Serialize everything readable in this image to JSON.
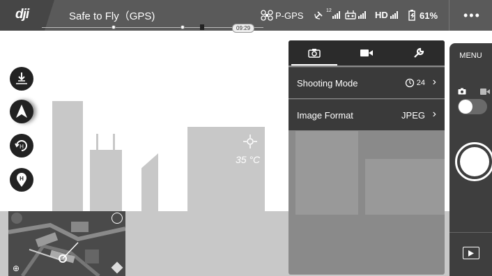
{
  "app": {
    "logo": "dji",
    "flight_status": "Safe to Fly（GPS)"
  },
  "status_bar": {
    "gps_mode": "P-GPS",
    "satellite_count": "12",
    "hd_label": "HD",
    "battery_percent": "61%"
  },
  "timeline": {
    "time": "09:29"
  },
  "scene": {
    "temperature": "35 °C"
  },
  "camera_panel": {
    "tabs": [
      "camera-icon",
      "video-icon",
      "wrench-icon"
    ],
    "active_tab": 0,
    "rows": [
      {
        "label": "Shooting Mode",
        "value": "24",
        "value_icon": "timer-icon"
      },
      {
        "label": "Image Format",
        "value": "JPEG"
      }
    ]
  },
  "right_panel": {
    "menu_label": "MENU",
    "mode_icons": [
      "camera-icon",
      "video-icon"
    ]
  },
  "colors": {
    "topbar": "#5a5a5a",
    "panel_dark": "#2b2b2b",
    "panel_row": "#3a3a3a",
    "building": "#c8c8c8"
  }
}
